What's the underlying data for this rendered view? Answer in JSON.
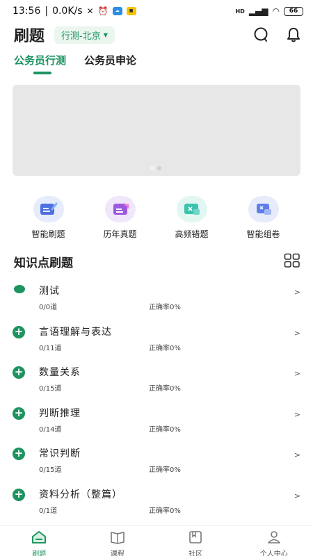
{
  "status": {
    "time": "13:56",
    "speed": "0.0K/s",
    "battery": "66",
    "net": "HD"
  },
  "header": {
    "title": "刷题",
    "region": "行测-北京"
  },
  "tabs": [
    {
      "label": "公务员行测"
    },
    {
      "label": "公务员申论"
    }
  ],
  "quick": [
    {
      "label": "智能刷题",
      "icon": "smart-practice-icon"
    },
    {
      "label": "历年真题",
      "icon": "past-papers-icon"
    },
    {
      "label": "高频错题",
      "icon": "frequent-errors-icon"
    },
    {
      "label": "智能组卷",
      "icon": "smart-paper-icon"
    }
  ],
  "section": {
    "title": "知识点刷题"
  },
  "topics": [
    {
      "name": "测试",
      "count": "0/0道",
      "rate": "正确率0%",
      "marker": "dot"
    },
    {
      "name": "言语理解与表达",
      "count": "0/11道",
      "rate": "正确率0%",
      "marker": "+"
    },
    {
      "name": "数量关系",
      "count": "0/15道",
      "rate": "正确率0%",
      "marker": "+"
    },
    {
      "name": "判断推理",
      "count": "0/14道",
      "rate": "正确率0%",
      "marker": "+"
    },
    {
      "name": "常识判断",
      "count": "0/15道",
      "rate": "正确率0%",
      "marker": "+"
    },
    {
      "name": "资料分析（整篇）",
      "count": "0/1道",
      "rate": "正确率0%",
      "marker": "+"
    }
  ],
  "nav": [
    {
      "label": "刷题",
      "icon": "home-icon"
    },
    {
      "label": "课程",
      "icon": "course-icon"
    },
    {
      "label": "社区",
      "icon": "community-icon"
    },
    {
      "label": "个人中心",
      "icon": "profile-icon"
    }
  ],
  "colors": {
    "accent": "#1d9460",
    "banner": "#e7e7e7"
  }
}
